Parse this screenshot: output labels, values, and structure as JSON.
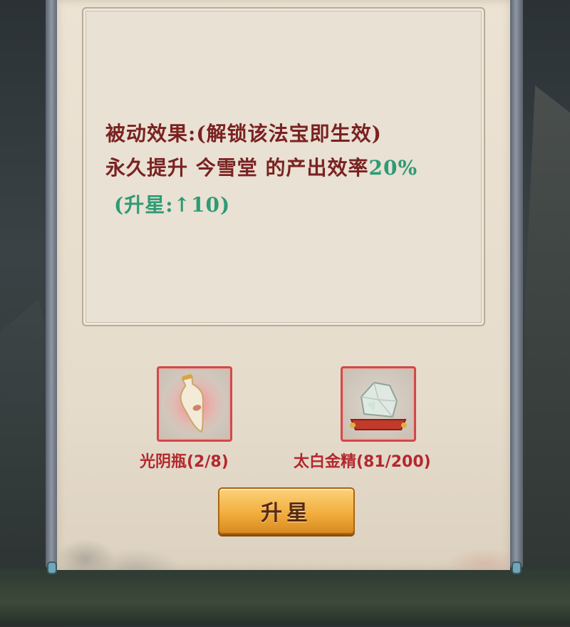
{
  "description": {
    "line1": "被动效果:(解锁该法宝即生效)",
    "line2_prefix": "永久提升 今雪堂 的产出效率",
    "line2_value": "20%",
    "line3": "(升星:↑10)"
  },
  "materials": [
    {
      "name": "光阴瓶(2/8)",
      "icon": "vase-icon"
    },
    {
      "name": "太白金精(81/200)",
      "icon": "ore-crystal-icon"
    }
  ],
  "upgrade_button": {
    "label": "升星"
  },
  "colors": {
    "text_dark_red": "#7a2222",
    "bonus_green": "#2f9a76",
    "material_red": "#b3282e",
    "button_gold": "#f2ae3e"
  }
}
